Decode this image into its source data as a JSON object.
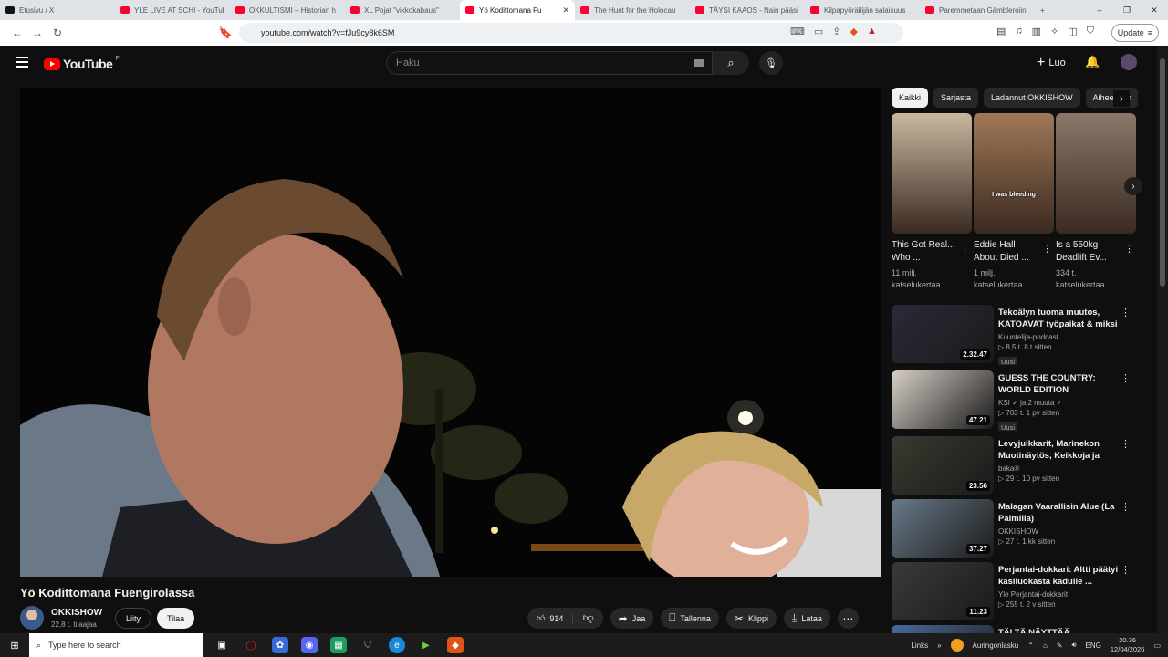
{
  "browser": {
    "tabs": [
      {
        "title": "Etusivu / X",
        "fav": "x"
      },
      {
        "title": "YLE LIVE AT SCHI - YouTube",
        "fav": "yt"
      },
      {
        "title": "OKKULTISMI – Historian h",
        "fav": "yt"
      },
      {
        "title": "XL Pojat \"vikkokabaus\"",
        "fav": "yt"
      },
      {
        "title": "Yö Kodittomana Fu",
        "fav": "yt",
        "active": true
      },
      {
        "title": "The Hunt for the Holocau",
        "fav": "yt"
      },
      {
        "title": "TÄYSI KAAOS - Nain pääsi",
        "fav": "yt"
      },
      {
        "title": "Kilpapyöräilijän salaisuus",
        "fav": "yt"
      },
      {
        "title": "Paremmetaan Gämbleroiin",
        "fav": "yt"
      }
    ],
    "new_tab": "+",
    "window_controls": {
      "minimize": "–",
      "restore": "❐",
      "close": "✕"
    },
    "url": "youtube.com/watch?v=fJu9cy8k6SM",
    "update_label": "Update"
  },
  "header": {
    "logo_text": "YouTube",
    "country_code": "FI",
    "search_placeholder": "Haku",
    "create_label": "Luo"
  },
  "video": {
    "title": "Yö Kodittomana Fuengirolassa",
    "channel": "OKKISHOW",
    "subscribers": "22,8 t. tilaajaa",
    "join_label": "Liity",
    "subscribe_label": "Tilaa",
    "likes": "914",
    "share_label": "Jaa",
    "save_label": "Tallenna",
    "clip_label": "Klippi",
    "download_label": "Lataa"
  },
  "chips": [
    "Kaikki",
    "Sarjasta",
    "Ladannut OKKISHOW",
    "Aiheeseen"
  ],
  "shorts": [
    {
      "title": "This Got Real... Who ...",
      "views": "11 milj. katselukertaa",
      "caption": "",
      "color": "#c8b8a0"
    },
    {
      "title": "Eddie Hall About Died ...",
      "views": "1 milj. katselukertaa",
      "caption": "I was bleeding",
      "color": "#a07858"
    },
    {
      "title": "Is a 550kg Deadlift Ev...",
      "views": "334 t. katselukertaa",
      "caption": "",
      "color": "#8a7868"
    }
  ],
  "related": [
    {
      "title": "Tekoälyn tuoma muutos, KATOAVAT työpaikat & miksi ...",
      "channel": "Kuuntelija-podcast",
      "meta": "8,5 t.   8 t sitten",
      "badge": "Uusi",
      "duration": "2.32.47",
      "color": "#2a2a3a"
    },
    {
      "title": "GUESS THE COUNTRY: WORLD EDITION",
      "channel": "KSI ✓ ja 2 muuta ✓",
      "meta": "703 t.   1 pv sitten",
      "badge": "Uusi",
      "duration": "47.21",
      "color": "#d8d0c8"
    },
    {
      "title": "Levyjulkkarit, Marinekon Muotinäytös, Keikkoja ja Imm...",
      "channel": "baka®",
      "meta": "29 t.   10 pv sitten",
      "badge": "",
      "duration": "23.56",
      "color": "#3a3a30"
    },
    {
      "title": "Malagan Vaarallisin Alue (La Palmilla)",
      "channel": "OKKISHOW",
      "meta": "27 t.   1 kk sitten",
      "badge": "",
      "duration": "37.27",
      "color": "#6a7a8a"
    },
    {
      "title": "Perjantai-dokkari: Altti päätyi kasiluokasta kadulle ...",
      "channel": "Yle Perjantai-dokkarit",
      "meta": "255 t.   2 v sitten",
      "badge": "",
      "duration": "11.23",
      "color": "#3a3a3a"
    },
    {
      "title": "TÄLTÄ NÄYTTÄÄ",
      "channel": "",
      "meta": "",
      "badge": "",
      "duration": "",
      "color": "#4a6a9a"
    }
  ],
  "taskbar": {
    "search_placeholder": "Type here to search",
    "links_label": "Links",
    "weather": "Auringonlasku",
    "lang": "ENG",
    "time": "20.36",
    "date": "12/04/2026"
  },
  "colors": {
    "accent": "#ff0000",
    "bg": "#0f0f0f"
  }
}
